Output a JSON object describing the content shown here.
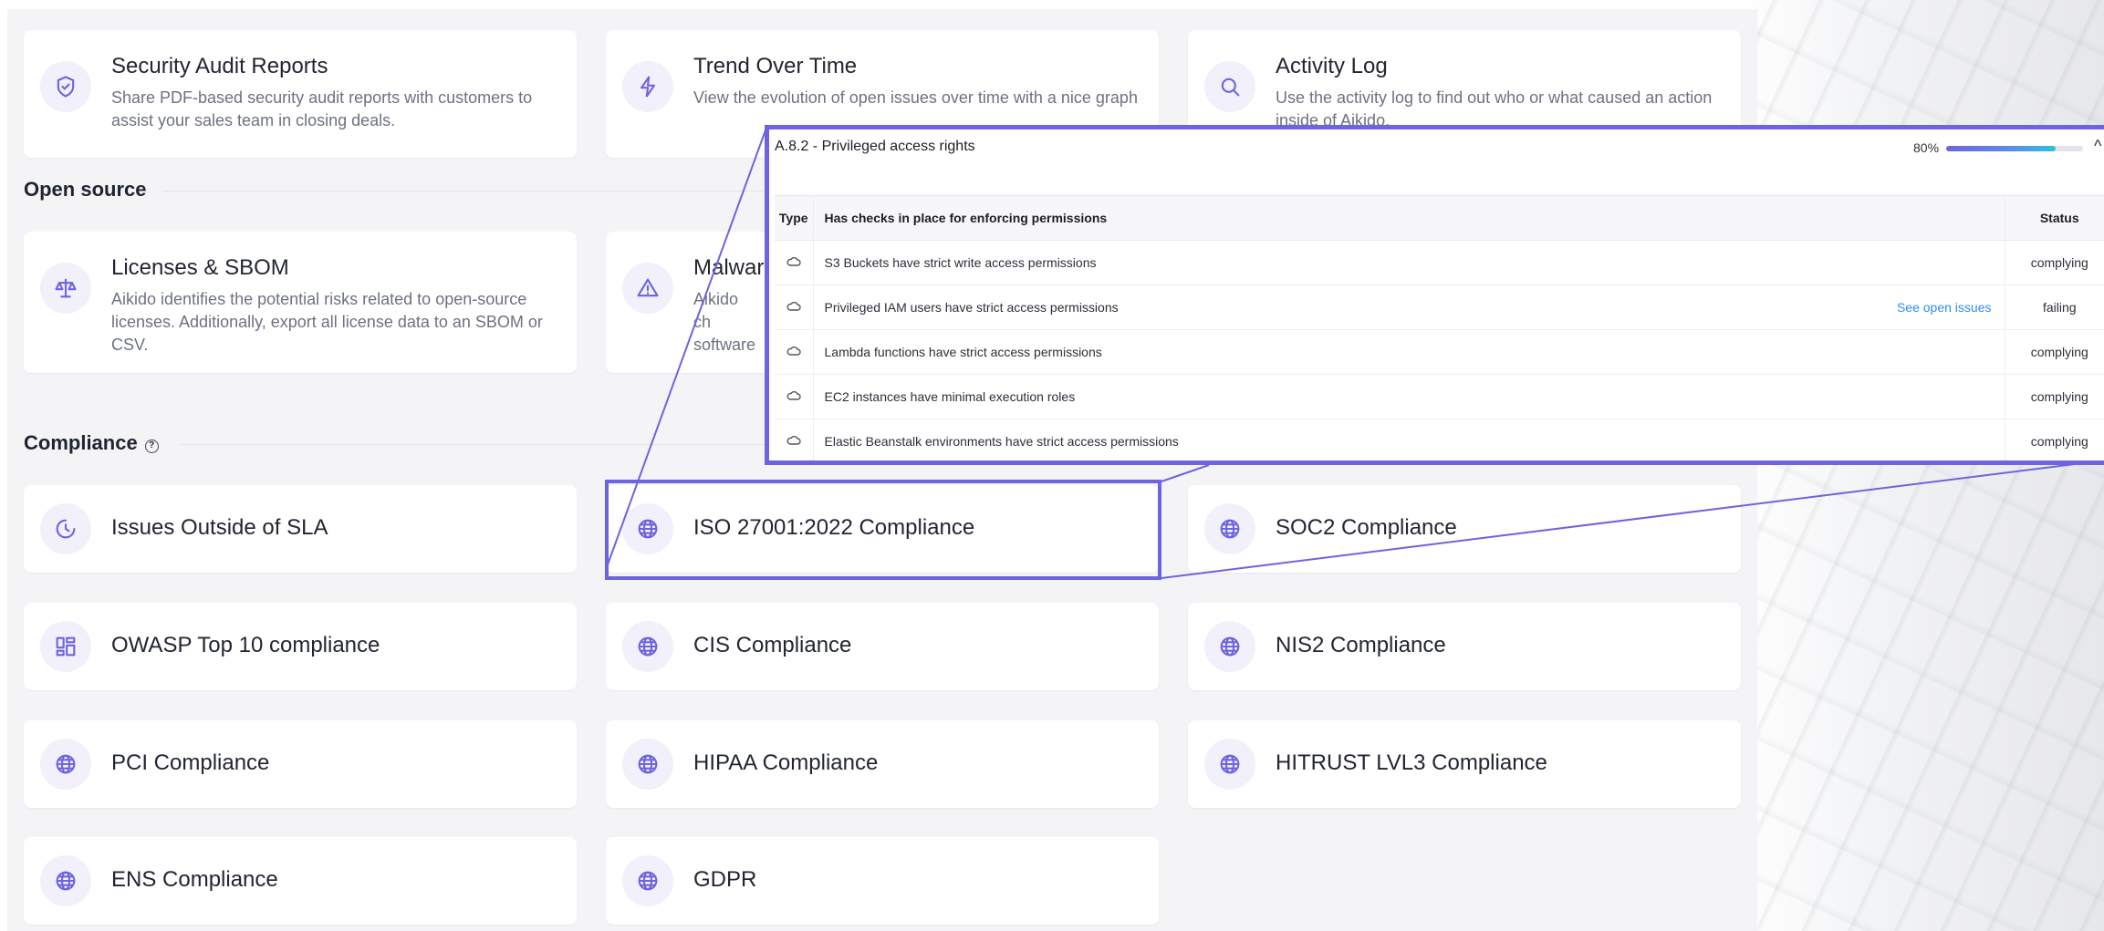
{
  "top_cards": [
    {
      "title": "Security Audit Reports",
      "desc": "Share PDF-based security audit reports with customers to assist your sales team in closing deals.",
      "icon": "shield-check-icon"
    },
    {
      "title": "Trend Over Time",
      "desc": "View the evolution of open issues over time with a nice graph",
      "icon": "lightning-icon"
    },
    {
      "title": "Activity Log",
      "desc": "Use the activity log to find out who or what caused an action inside of Aikido.",
      "icon": "magnifier-icon"
    }
  ],
  "open_source": {
    "title": "Open source",
    "cards": [
      {
        "title": "Licenses & SBOM",
        "desc": "Aikido identifies the potential risks related to open-source licenses. Additionally, export all license data to an SBOM or CSV.",
        "icon": "scale-icon"
      },
      {
        "title": "Malwar",
        "desc": "Aikido ch software",
        "icon": "warning-icon"
      }
    ]
  },
  "compliance": {
    "title": "Compliance",
    "help": "?",
    "cards": [
      {
        "title": "Issues Outside of SLA",
        "icon": "clock-icon"
      },
      {
        "title": "ISO 27001:2022 Compliance",
        "icon": "globe-icon"
      },
      {
        "title": "SOC2 Compliance",
        "icon": "globe-icon"
      },
      {
        "title": "OWASP Top 10 compliance",
        "icon": "dashboard-icon"
      },
      {
        "title": "CIS Compliance",
        "icon": "globe-icon"
      },
      {
        "title": "NIS2 Compliance",
        "icon": "globe-icon"
      },
      {
        "title": "PCI Compliance",
        "icon": "globe-icon"
      },
      {
        "title": "HIPAA Compliance",
        "icon": "globe-icon"
      },
      {
        "title": "HITRUST LVL3 Compliance",
        "icon": "globe-icon"
      },
      {
        "title": "ENS Compliance",
        "icon": "globe-icon"
      },
      {
        "title": "GDPR",
        "icon": "globe-icon"
      }
    ]
  },
  "zoom": {
    "control": "A.8.2 - Privileged access rights",
    "progress_label": "80%",
    "progress": 0.8,
    "chevron": "^",
    "columns": {
      "type": "Type",
      "check": "Has checks in place for enforcing permissions",
      "status": "Status"
    },
    "rows": [
      {
        "name": "S3 Buckets have strict write access permissions",
        "link": "",
        "status": "complying"
      },
      {
        "name": "Privileged IAM users have strict access permissions",
        "link": "See open issues",
        "status": "failing"
      },
      {
        "name": "Lambda functions have strict access permissions",
        "link": "",
        "status": "complying"
      },
      {
        "name": "EC2 instances have minimal execution roles",
        "link": "",
        "status": "complying"
      },
      {
        "name": "Elastic Beanstalk environments have strict access permissions",
        "link": "",
        "status": "complying"
      }
    ],
    "colors": {
      "accent": "#6e63e0",
      "ok": "#1d9a57",
      "fail": "#d23a3a",
      "link": "#2c8ef0"
    }
  }
}
